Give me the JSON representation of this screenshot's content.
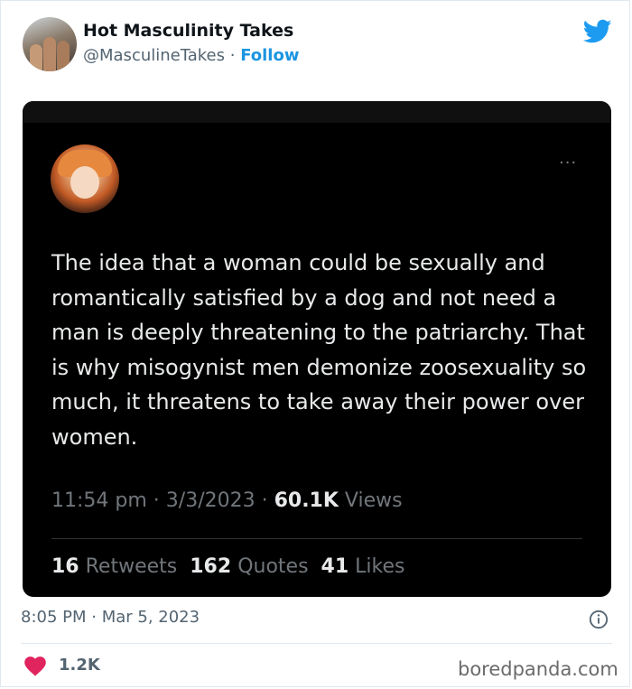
{
  "author": {
    "name": "Hot Masculinity Takes",
    "handle": "@MasculineTakes",
    "separator": " · ",
    "follow_label": "Follow"
  },
  "embedded_tweet": {
    "more_label": "···",
    "text": "The idea that a woman could be sexually and romantically satisfied by a dog and not need a man is deeply threatening to the patriarchy. That is why misogynist men demonize zoosexuality so much, it threatens to take away their power over women.",
    "time": "11:54 pm",
    "date": "3/3/2023",
    "meta_sep": " · ",
    "views_count": "60.1K",
    "views_label": "Views",
    "retweets_count": "16",
    "retweets_label": "Retweets",
    "quotes_count": "162",
    "quotes_label": "Quotes",
    "likes_count": "41",
    "likes_label": "Likes"
  },
  "footer": {
    "timestamp": "8:05 PM · Mar 5, 2023",
    "like_count": "1.2K",
    "watermark": "boredpanda.com"
  },
  "colors": {
    "twitter_blue": "#1d9bf0",
    "heart_red": "#e0245e",
    "embed_bg": "#000000"
  },
  "icons": [
    "twitter-bird-icon",
    "info-icon",
    "heart-icon",
    "more-icon"
  ]
}
